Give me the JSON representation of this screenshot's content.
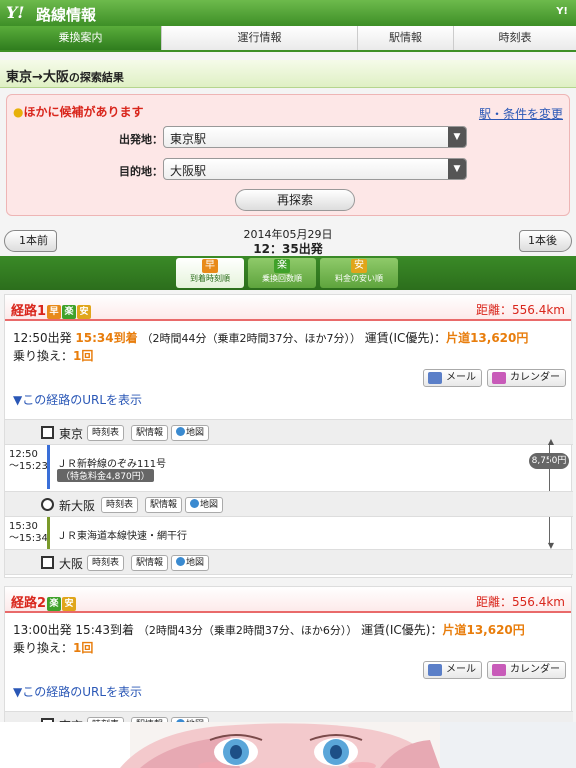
{
  "app": {
    "logo": "Y!",
    "title": "路線情報",
    "corner_mark": "Y!"
  },
  "tabs": [
    "乗換案内",
    "運行情報",
    "駅情報",
    "時刻表"
  ],
  "result_title": {
    "text": "東京→大阪",
    "suffix": "の探索結果"
  },
  "search": {
    "alt_candidates": "ほかに候補があります",
    "change_link": "駅・条件を変更",
    "from_label": "出発地：",
    "from_value": "東京駅",
    "to_label": "目的地：",
    "to_value": "大阪駅",
    "research_label": "再探索"
  },
  "timebar": {
    "prev": "1本前",
    "next": "1本後",
    "date": "2014年05月29日",
    "departure": "12：35出発"
  },
  "sort": [
    {
      "icon": "早",
      "label": "到着時刻順"
    },
    {
      "icon": "楽",
      "label": "乗換回数順"
    },
    {
      "icon": "安",
      "label": "料金の安い順"
    }
  ],
  "routes": [
    {
      "name": "経路1",
      "badges": [
        "早",
        "楽",
        "安"
      ],
      "distance": "距離：556.4km",
      "depart": "12:50出発",
      "arrive": "15:34到着",
      "duration": "（2時間44分（乗車2時間37分、ほか7分））",
      "fare_label": "運賃(IC優先)：",
      "fare_value": "片道13,620円",
      "transfer_label": "乗り換え：",
      "transfer_value": "1回",
      "mail": "メール",
      "calendar": "カレンダー",
      "url_link": "▼この経路のURLを表示",
      "stations": [
        "東京",
        "新大阪",
        "大阪"
      ],
      "chips": [
        "時刻表",
        "駅情報",
        "地図"
      ],
      "segments": [
        {
          "time_from": "12:50",
          "time_to": "〜15:23",
          "train": "ＪＲ新幹線のぞみ111号",
          "note": "（特急料金4,870円）",
          "color": "#3a6fd8"
        },
        {
          "time_from": "15:30",
          "time_to": "〜15:34",
          "train": "ＪＲ東海道本線快速・網干行",
          "note": "",
          "color": "#7a9a2a"
        }
      ],
      "fare_pill": "8,750円"
    },
    {
      "name": "経路2",
      "badges": [
        "楽",
        "安"
      ],
      "distance": "距離：556.4km",
      "depart": "13:00出発",
      "arrive": "15:43到着",
      "duration": "（2時間43分（乗車2時間37分、ほか6分））",
      "fare_label": "運賃(IC優先)：",
      "fare_value": "片道13,620円",
      "transfer_label": "乗り換え：",
      "transfer_value": "1回",
      "mail": "メール",
      "calendar": "カレンダー",
      "url_link": "▼この経路のURLを表示",
      "stations": [
        "東京"
      ],
      "chips": [
        "時刻表",
        "駅情報",
        "地図"
      ]
    }
  ]
}
